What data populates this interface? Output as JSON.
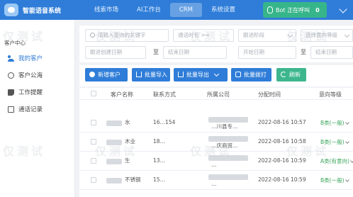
{
  "app": {
    "title": "智能语音系统"
  },
  "nav": {
    "items": [
      "线索市场",
      "AI工作台",
      "CRM",
      "系统设置"
    ],
    "active_index": 2
  },
  "bot": {
    "label": "Bot 正在呼叫",
    "count": "0"
  },
  "sidebar": {
    "section_title": "客户中心",
    "items": [
      {
        "label": "我的客户",
        "icon": "users-icon",
        "active": true
      },
      {
        "label": "客户公海",
        "icon": "sea-icon",
        "active": false
      },
      {
        "label": "工作提醒",
        "icon": "bell-icon",
        "active": false
      },
      {
        "label": "通话记录",
        "icon": "record-icon",
        "active": false
      }
    ]
  },
  "filters": {
    "search_placeholder": "请输入查询的关键字",
    "duration_placeholder": "通话时长 >=",
    "stage_placeholder": "跟进阶段",
    "grade_placeholder": "选择意向等级",
    "created_start": "跟进创建日期",
    "created_end": "结束日期",
    "follow_start": "开始日期",
    "to_label": "至"
  },
  "toolbar": {
    "add_label": "新增客户",
    "import_label": "批量导入",
    "export_label": "批量导出",
    "dial_label": "批量拨打",
    "refresh_label": "刷新"
  },
  "table": {
    "headers": [
      "客户名称",
      "联系方式",
      "所属公司",
      "分配时间",
      "意向等级"
    ],
    "rows": [
      {
        "name": "水",
        "phone": "16…154",
        "company": "…川县专…",
        "assigned": "2022-08-16 10:57",
        "grade": "B类(一般)",
        "grade_color": "green"
      },
      {
        "name": "木业",
        "phone": "18…",
        "company": "…庆商贸…",
        "assigned": "2022-08-16 10:58",
        "grade": "B类(一般)",
        "grade_color": "green"
      },
      {
        "name": "生",
        "phone": "13…",
        "company": "…",
        "assigned": "2022-08-16 10:59",
        "grade": "A类(有意向)",
        "grade_color": "green"
      },
      {
        "name": "不锈钢",
        "phone": "15…",
        "company": "…",
        "assigned": "2022-08-16 10:59",
        "grade": "B类(一般)",
        "grade_color": "green"
      }
    ]
  },
  "watermark": {
    "text": "仅测试"
  },
  "colors": {
    "primary": "#2f7dd8",
    "success": "#3db68d",
    "bot_green": "#36b58a"
  }
}
